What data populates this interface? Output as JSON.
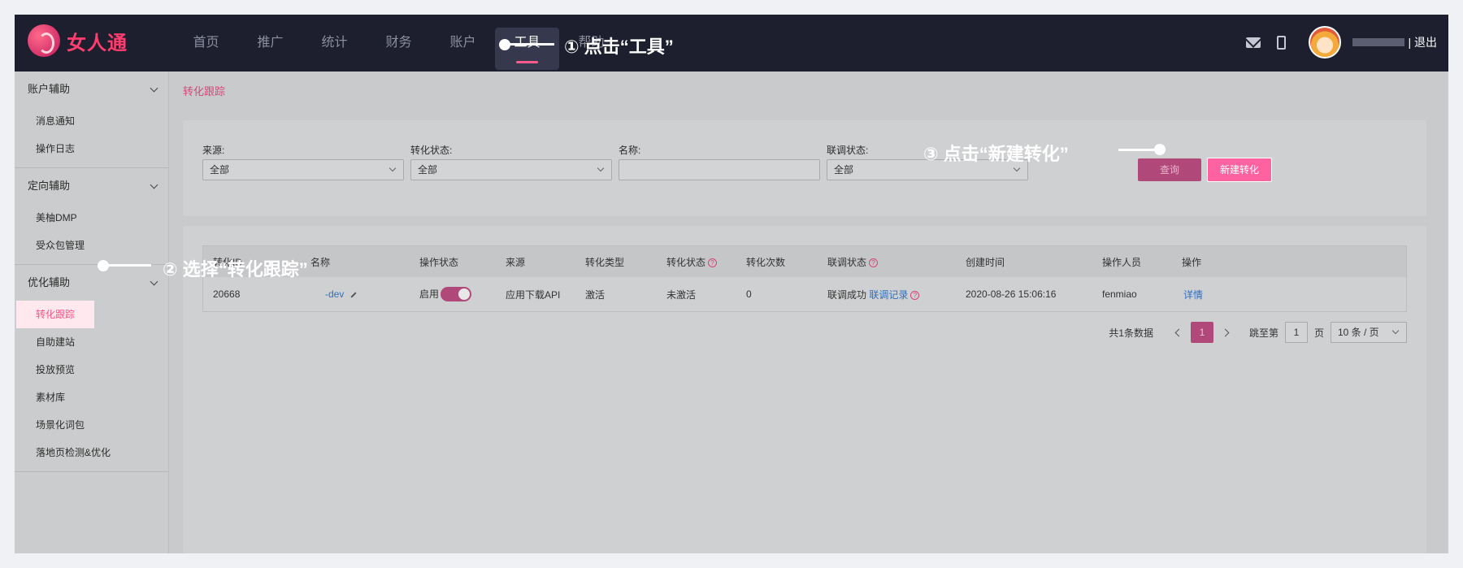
{
  "brand": {
    "name": "女人通"
  },
  "nav": {
    "items": [
      {
        "label": "首页"
      },
      {
        "label": "推广"
      },
      {
        "label": "统计"
      },
      {
        "label": "财务"
      },
      {
        "label": "账户"
      },
      {
        "label": "工具"
      },
      {
        "label": "帮助"
      }
    ],
    "active": "工具"
  },
  "top_right": {
    "logout_label": "| 退出"
  },
  "sidebar": {
    "groups": [
      {
        "title": "账户辅助",
        "items": [
          "消息通知",
          "操作日志"
        ]
      },
      {
        "title": "定向辅助",
        "items": [
          "美柚DMP",
          "受众包管理"
        ]
      },
      {
        "title": "优化辅助",
        "items": [
          "转化跟踪",
          "自助建站",
          "投放预览",
          "素材库",
          "场景化词包",
          "落地页检测&优化"
        ]
      }
    ],
    "active_item": "转化跟踪"
  },
  "breadcrumb": "转化跟踪",
  "filters": {
    "source": {
      "label": "来源:",
      "value": "全部"
    },
    "status": {
      "label": "转化状态:",
      "value": "全部"
    },
    "name": {
      "label": "名称:",
      "value": ""
    },
    "debug_status": {
      "label": "联调状态:",
      "value": "全部"
    },
    "query_button": "查询",
    "new_button": "新建转化"
  },
  "table": {
    "headers": [
      "转化ID",
      "名称",
      "操作状态",
      "来源",
      "转化类型",
      "转化状态",
      "转化次数",
      "联调状态",
      "创建时间",
      "操作人员",
      "操作"
    ],
    "rows": [
      {
        "id": "20668",
        "name": "-dev",
        "op_status": "启用",
        "source": "应用下载API",
        "type": "激活",
        "conv_status": "未激活",
        "count": "0",
        "debug_status": "联调成功",
        "debug_link": "联调记录",
        "created": "2020-08-26 15:06:16",
        "operator": "fenmiao",
        "action": "详情"
      }
    ]
  },
  "pager": {
    "total": "共1条数据",
    "current": "1",
    "jump_label": "跳至第",
    "jump_value": "1",
    "page_suffix": "页",
    "page_size": "10 条 / 页"
  },
  "annotations": {
    "step1": "① 点击“工具”",
    "step2": "② 选择“转化跟踪”",
    "step3": "③ 点击“新建转化”"
  },
  "colors": {
    "topbar": "#1d1f2e",
    "accent": "#ff5b8c",
    "overlay": "#c9cacb"
  }
}
